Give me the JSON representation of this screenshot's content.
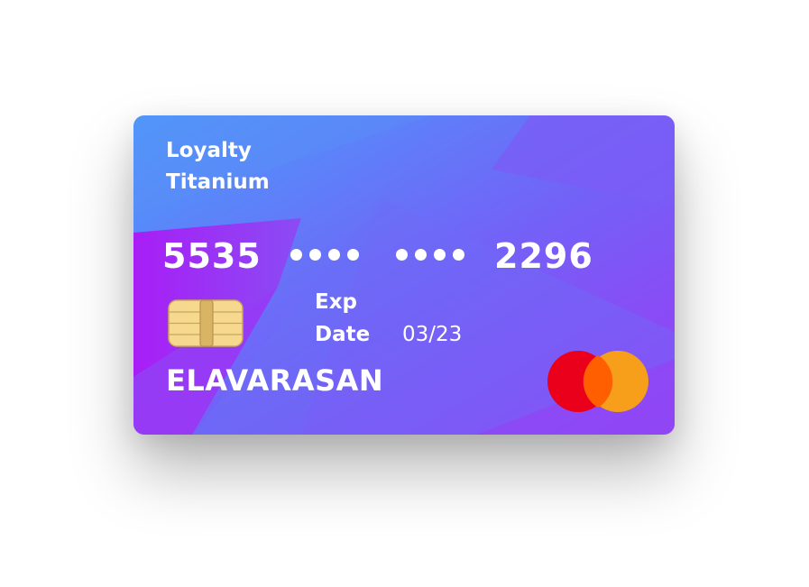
{
  "card": {
    "tier_line1": "Loyalty",
    "tier_line2": "Titanium",
    "number_first": "5535",
    "number_last": "2296",
    "exp_label_line1": "Exp",
    "exp_label_line2": "Date",
    "exp_value": "03/23",
    "holder_name": "ELAVARASAN",
    "network_icon": "mastercard-logo-icon",
    "chip_icon": "emv-chip-icon",
    "colors": {
      "gradient_start": "#4a9dfb",
      "gradient_mid": "#7b5cf5",
      "gradient_end": "#a020f0",
      "mc_red": "#eb001b",
      "mc_orange": "#f79e1b",
      "mc_overlap": "#ff5f00"
    }
  }
}
